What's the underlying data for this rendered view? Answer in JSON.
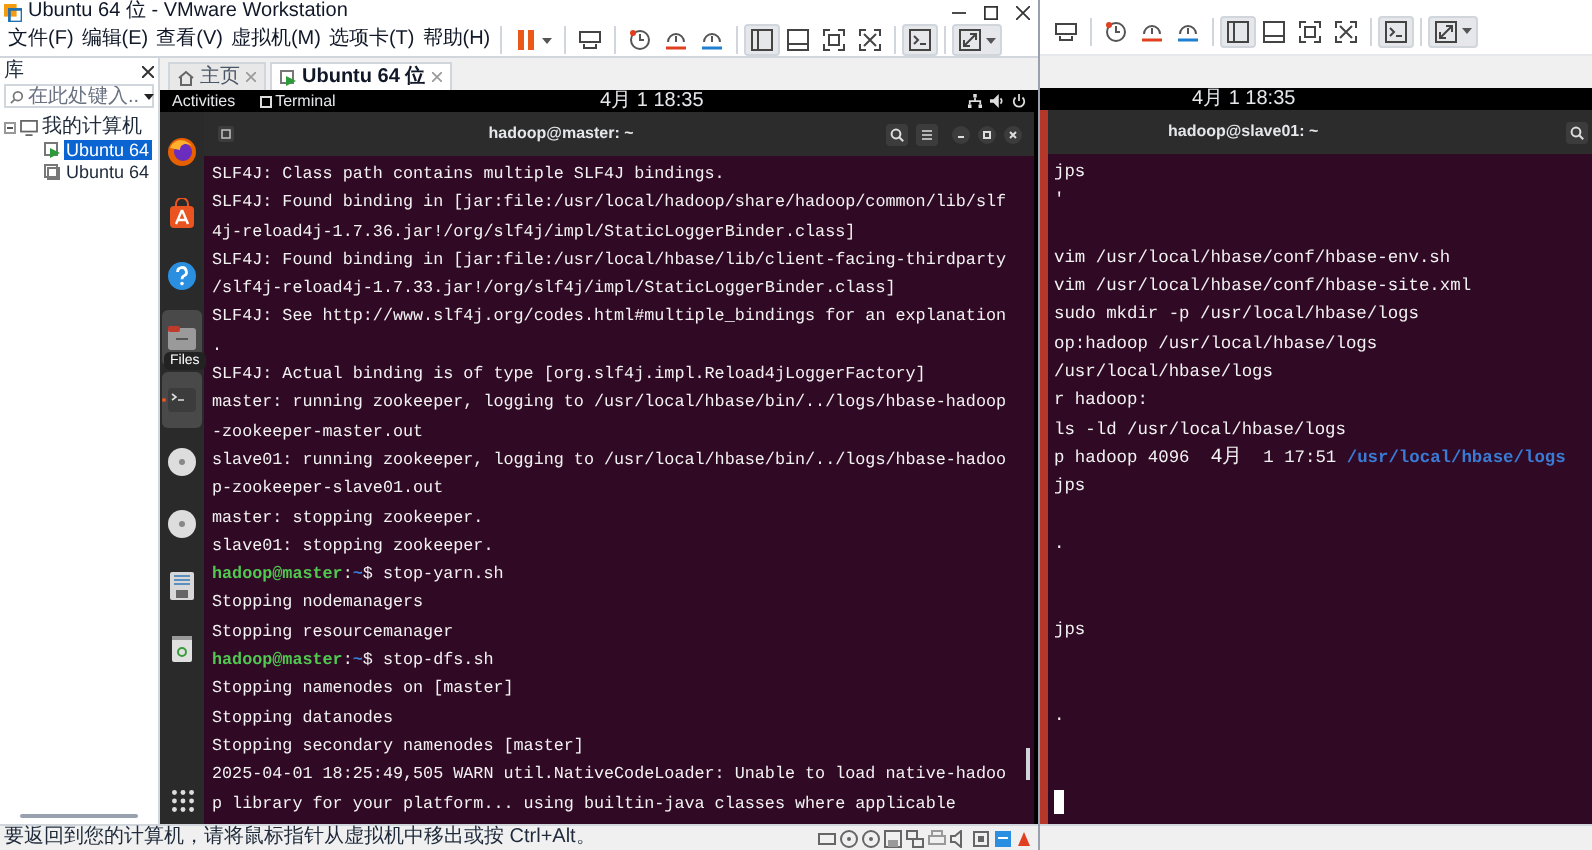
{
  "vmware_window": {
    "title": "Ubuntu 64 位 - VMware Workstation",
    "menu": [
      "文件(F)",
      "编辑(E)",
      "查看(V)",
      "虚拟机(M)",
      "选项卡(T)",
      "帮助(H)"
    ],
    "toolbar": [
      {
        "kind": "pause",
        "pressed": false
      },
      {
        "kind": "send-keys",
        "pressed": false
      },
      {
        "kind": "snapshot-take",
        "pressed": false
      },
      {
        "kind": "snapshot-revert",
        "pressed": false
      },
      {
        "kind": "snapshot-manager",
        "pressed": false
      },
      {
        "kind": "view-library",
        "pressed": true
      },
      {
        "kind": "view-thumbnails",
        "pressed": false
      },
      {
        "kind": "view-fullscreen",
        "pressed": false
      },
      {
        "kind": "view-unity",
        "pressed": false
      },
      {
        "kind": "console",
        "pressed": true
      },
      {
        "kind": "stretch",
        "pressed": true
      }
    ],
    "library": {
      "title": "库",
      "search": {
        "placeholder": "在此处键入..."
      },
      "tree": [
        {
          "label": "我的计算机",
          "expanded": true,
          "children": [
            {
              "label": "Ubuntu 64",
              "selected": true,
              "running": true
            },
            {
              "label": "Ubuntu 64",
              "selected": false,
              "running": false
            }
          ]
        }
      ]
    },
    "tabs": [
      {
        "label": "主页",
        "selected": false
      },
      {
        "label": "Ubuntu 64 位",
        "selected": true
      }
    ],
    "guest": {
      "top_bar": {
        "activities": "Activities",
        "app": "Terminal",
        "clock": "4月 1 18:35"
      },
      "dock": [
        {
          "kind": "browser",
          "running": false,
          "highlighted": false
        },
        {
          "kind": "store",
          "running": false,
          "highlighted": false
        },
        {
          "kind": "help",
          "running": false,
          "highlighted": false
        },
        {
          "kind": "files",
          "running": false,
          "highlighted": true
        },
        {
          "kind": "terminal",
          "running": true,
          "highlighted": true
        },
        {
          "kind": "disc",
          "running": false,
          "highlighted": false
        },
        {
          "kind": "disc",
          "running": false,
          "highlighted": false
        },
        {
          "kind": "floppy",
          "running": false,
          "highlighted": false
        },
        {
          "kind": "trash",
          "running": false,
          "highlighted": false
        }
      ],
      "tooltip": "Files",
      "terminal": {
        "title": "hadoop@master: ~",
        "lines": [
          {
            "kind": "text",
            "segments": [
              {
                "kind": "plain",
                "text": "SLF4J: Class path contains multiple SLF4J bindings."
              }
            ]
          },
          {
            "kind": "text",
            "segments": [
              {
                "kind": "plain",
                "text": "SLF4J: Found binding in [jar:file:/usr/local/hadoop/share/hadoop/common/lib/slf"
              }
            ]
          },
          {
            "kind": "text",
            "segments": [
              {
                "kind": "plain",
                "text": "4j-reload4j-1.7.36.jar!/org/slf4j/impl/StaticLoggerBinder.class]"
              }
            ]
          },
          {
            "kind": "text",
            "segments": [
              {
                "kind": "plain",
                "text": "SLF4J: Found binding in [jar:file:/usr/local/hbase/lib/client-facing-thirdparty"
              }
            ]
          },
          {
            "kind": "text",
            "segments": [
              {
                "kind": "plain",
                "text": "/slf4j-reload4j-1.7.33.jar!/org/slf4j/impl/StaticLoggerBinder.class]"
              }
            ]
          },
          {
            "kind": "text",
            "segments": [
              {
                "kind": "plain",
                "text": "SLF4J: See http://www.slf4j.org/codes.html#multiple_bindings for an explanation"
              }
            ]
          },
          {
            "kind": "text",
            "segments": [
              {
                "kind": "plain",
                "text": "."
              }
            ]
          },
          {
            "kind": "text",
            "segments": [
              {
                "kind": "plain",
                "text": "SLF4J: Actual binding is of type [org.slf4j.impl.Reload4jLoggerFactory]"
              }
            ]
          },
          {
            "kind": "text",
            "segments": [
              {
                "kind": "plain",
                "text": "master: running zookeeper, logging to /usr/local/hbase/bin/../logs/hbase-hadoop"
              }
            ]
          },
          {
            "kind": "text",
            "segments": [
              {
                "kind": "plain",
                "text": "-zookeeper-master.out"
              }
            ]
          },
          {
            "kind": "text",
            "segments": [
              {
                "kind": "plain",
                "text": "slave01: running zookeeper, logging to /usr/local/hbase/bin/../logs/hbase-hadoo"
              }
            ]
          },
          {
            "kind": "text",
            "segments": [
              {
                "kind": "plain",
                "text": "p-zookeeper-slave01.out"
              }
            ]
          },
          {
            "kind": "text",
            "segments": [
              {
                "kind": "plain",
                "text": "master: stopping zookeeper."
              }
            ]
          },
          {
            "kind": "text",
            "segments": [
              {
                "kind": "plain",
                "text": "slave01: stopping zookeeper."
              }
            ]
          },
          {
            "kind": "text",
            "segments": [
              {
                "kind": "user",
                "text": "hadoop@master"
              },
              {
                "kind": "plain",
                "text": ":"
              },
              {
                "kind": "dir",
                "text": "~"
              },
              {
                "kind": "plain",
                "text": "$ stop-yarn.sh"
              }
            ]
          },
          {
            "kind": "text",
            "segments": [
              {
                "kind": "plain",
                "text": "Stopping nodemanagers"
              }
            ]
          },
          {
            "kind": "text",
            "segments": [
              {
                "kind": "plain",
                "text": "Stopping resourcemanager"
              }
            ]
          },
          {
            "kind": "text",
            "segments": [
              {
                "kind": "user",
                "text": "hadoop@master"
              },
              {
                "kind": "plain",
                "text": ":"
              },
              {
                "kind": "dir",
                "text": "~"
              },
              {
                "kind": "plain",
                "text": "$ stop-dfs.sh"
              }
            ]
          },
          {
            "kind": "text",
            "segments": [
              {
                "kind": "plain",
                "text": "Stopping namenodes on [master]"
              }
            ]
          },
          {
            "kind": "text",
            "segments": [
              {
                "kind": "plain",
                "text": "Stopping datanodes"
              }
            ]
          },
          {
            "kind": "text",
            "segments": [
              {
                "kind": "plain",
                "text": "Stopping secondary namenodes [master]"
              }
            ]
          },
          {
            "kind": "text",
            "segments": [
              {
                "kind": "plain",
                "text": "2025-04-01 18:25:49,505 WARN util.NativeCodeLoader: Unable to load native-hadoo"
              }
            ]
          },
          {
            "kind": "text",
            "segments": [
              {
                "kind": "plain",
                "text": "p library for your platform... using builtin-java classes where applicable"
              }
            ]
          }
        ]
      }
    },
    "status_bar": {
      "message": "要返回到您的计算机，请将鼠标指针从虚拟机中移出或按 Ctrl+Alt。"
    }
  },
  "second_window": {
    "toolbar": [
      {
        "kind": "send-keys",
        "pressed": false
      },
      {
        "kind": "snapshot-take",
        "pressed": false
      },
      {
        "kind": "snapshot-revert",
        "pressed": false
      },
      {
        "kind": "snapshot-manager",
        "pressed": false
      },
      {
        "kind": "view-library",
        "pressed": true
      },
      {
        "kind": "view-thumbnails",
        "pressed": false
      },
      {
        "kind": "view-fullscreen",
        "pressed": false
      },
      {
        "kind": "view-unity",
        "pressed": false
      },
      {
        "kind": "console",
        "pressed": true
      },
      {
        "kind": "stretch",
        "pressed": true
      }
    ],
    "guest": {
      "clock": "4月 1 18:35",
      "terminal": {
        "title": "hadoop@slave01: ~",
        "lines": [
          {
            "kind": "text",
            "segments": [
              {
                "kind": "plain",
                "text": "jps"
              }
            ]
          },
          {
            "kind": "text",
            "segments": [
              {
                "kind": "plain",
                "text": "'"
              }
            ]
          },
          {
            "kind": "blank"
          },
          {
            "kind": "text",
            "segments": [
              {
                "kind": "plain",
                "text": "vim /usr/local/hbase/conf/hbase-env.sh"
              }
            ]
          },
          {
            "kind": "text",
            "segments": [
              {
                "kind": "plain",
                "text": "vim /usr/local/hbase/conf/hbase-site.xml"
              }
            ]
          },
          {
            "kind": "text",
            "segments": [
              {
                "kind": "plain",
                "text": "sudo mkdir -p /usr/local/hbase/logs"
              }
            ]
          },
          {
            "kind": "text",
            "segments": [
              {
                "kind": "plain",
                "text": "op:hadoop /usr/local/hbase/logs"
              }
            ]
          },
          {
            "kind": "text",
            "segments": [
              {
                "kind": "plain",
                "text": "/usr/local/hbase/logs"
              }
            ]
          },
          {
            "kind": "text",
            "segments": [
              {
                "kind": "plain",
                "text": "r hadoop:"
              }
            ]
          },
          {
            "kind": "text",
            "segments": [
              {
                "kind": "plain",
                "text": "ls -ld /usr/local/hbase/logs"
              }
            ]
          },
          {
            "kind": "text",
            "segments": [
              {
                "kind": "plain",
                "text": "p hadoop 4096  "
              },
              {
                "kind": "cjk",
                "text": "4月"
              },
              {
                "kind": "plain",
                "text": "  1 17:51 "
              },
              {
                "kind": "dir",
                "text": "/usr/local/hbase/logs"
              }
            ]
          },
          {
            "kind": "text",
            "segments": [
              {
                "kind": "plain",
                "text": "jps"
              }
            ]
          },
          {
            "kind": "blank"
          },
          {
            "kind": "text",
            "segments": [
              {
                "kind": "plain",
                "text": "."
              }
            ]
          },
          {
            "kind": "blank"
          },
          {
            "kind": "blank"
          },
          {
            "kind": "text",
            "segments": [
              {
                "kind": "plain",
                "text": "jps"
              }
            ]
          },
          {
            "kind": "blank"
          },
          {
            "kind": "blank"
          },
          {
            "kind": "text",
            "segments": [
              {
                "kind": "plain",
                "text": "."
              }
            ]
          },
          {
            "kind": "blank"
          },
          {
            "kind": "blank"
          },
          {
            "kind": "cursor"
          }
        ]
      }
    }
  }
}
